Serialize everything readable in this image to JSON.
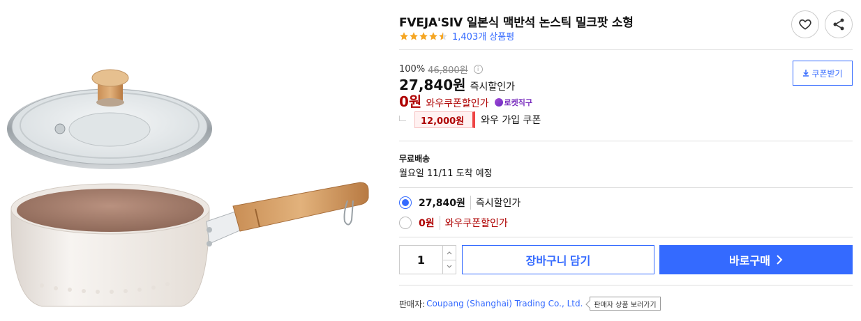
{
  "product": {
    "title": "FVEJA'SIV 일본식 맥반석 논스틱 밀크팟 소형",
    "image_icon": "milk-pan-with-lid",
    "rating_stars": 4.5,
    "review_count_text": "1,403개 상품평"
  },
  "pricing": {
    "discount_rate": "100%",
    "original_price": "46,800원",
    "sale_price": "27,840원",
    "sale_desc": "즉시할인가",
    "wow_price": "0원",
    "wow_desc": "와우쿠폰할인가",
    "rocket_badge": "로켓직구",
    "coupon_amount": "12,000원",
    "coupon_label": "와우 가입 쿠폰",
    "coupon_button": "쿠폰받기"
  },
  "shipping": {
    "title": "무료배송",
    "date": "월요일 11/11 도착 예정"
  },
  "options": [
    {
      "price": "27,840원",
      "label": "즉시할인가",
      "selected": true
    },
    {
      "price": "0원",
      "label": "와우쿠폰할인가",
      "selected": false
    }
  ],
  "purchase": {
    "quantity": "1",
    "cart_label": "장바구니 담기",
    "buy_label": "바로구매"
  },
  "seller": {
    "label": "판매자:",
    "name": "Coupang (Shanghai) Trading Co., Ltd.",
    "tooltip": "판매자 상품 보러가기"
  },
  "colors": {
    "accent": "#346aff",
    "wow_red": "#ae0000",
    "star": "#f5a623"
  }
}
